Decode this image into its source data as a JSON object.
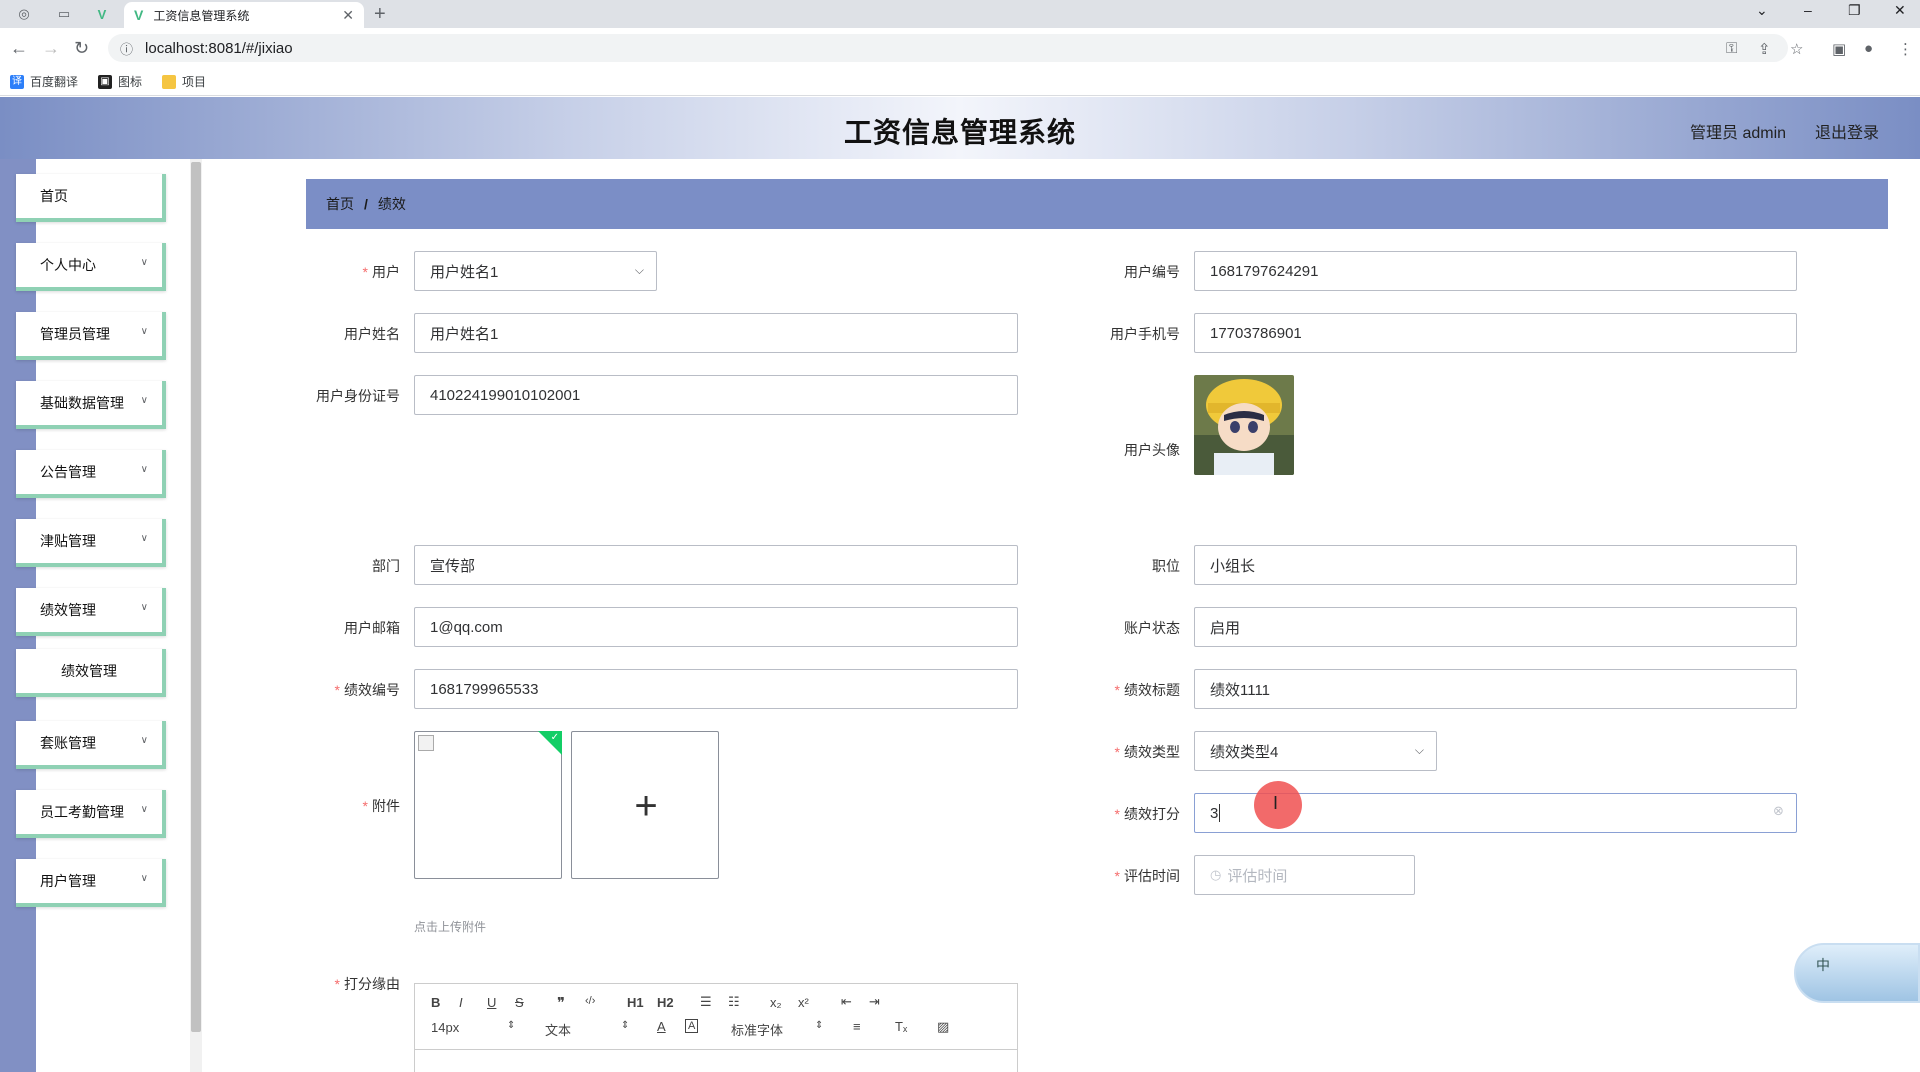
{
  "browser": {
    "tab_title": "工资信息管理系统",
    "url": "localhost:8081/#/jixiao",
    "bookmarks": [
      "百度翻译",
      "图标",
      "项目"
    ]
  },
  "header": {
    "title": "工资信息管理系统",
    "admin_label": "管理员 admin",
    "logout_label": "退出登录"
  },
  "sidebar": {
    "items": [
      {
        "label": "首页"
      },
      {
        "label": "个人中心"
      },
      {
        "label": "管理员管理"
      },
      {
        "label": "基础数据管理"
      },
      {
        "label": "公告管理"
      },
      {
        "label": "津贴管理"
      },
      {
        "label": "绩效管理"
      },
      {
        "label": "绩效管理"
      },
      {
        "label": "套账管理"
      },
      {
        "label": "员工考勤管理"
      },
      {
        "label": "用户管理"
      }
    ]
  },
  "breadcrumb": {
    "home": "首页",
    "current": "绩效",
    "separator": "/"
  },
  "form": {
    "user_label": "用户",
    "user_value": "用户姓名1",
    "user_no_label": "用户编号",
    "user_no_value": "1681797624291",
    "user_name_label": "用户姓名",
    "user_name_value": "用户姓名1",
    "user_phone_label": "用户手机号",
    "user_phone_value": "17703786901",
    "user_id_label": "用户身份证号",
    "user_id_value": "410224199010102001",
    "user_avatar_label": "用户头像",
    "dept_label": "部门",
    "dept_value": "宣传部",
    "position_label": "职位",
    "position_value": "小组长",
    "email_label": "用户邮箱",
    "email_value": "1@qq.com",
    "account_status_label": "账户状态",
    "account_status_value": "启用",
    "perf_no_label": "绩效编号",
    "perf_no_value": "1681799965533",
    "perf_title_label": "绩效标题",
    "perf_title_value": "绩效1111",
    "attachment_label": "附件",
    "upload_tip": "点击上传附件",
    "perf_type_label": "绩效类型",
    "perf_type_value": "绩效类型4",
    "perf_score_label": "绩效打分",
    "perf_score_value": "3",
    "eval_time_label": "评估时间",
    "eval_time_placeholder": "评估时间",
    "reason_label": "打分缘由"
  },
  "editor": {
    "font_size": "14px",
    "text_style": "文本",
    "font_family": "标准字体",
    "h1": "H1",
    "h2": "H2"
  },
  "widget": {
    "label": "中"
  }
}
